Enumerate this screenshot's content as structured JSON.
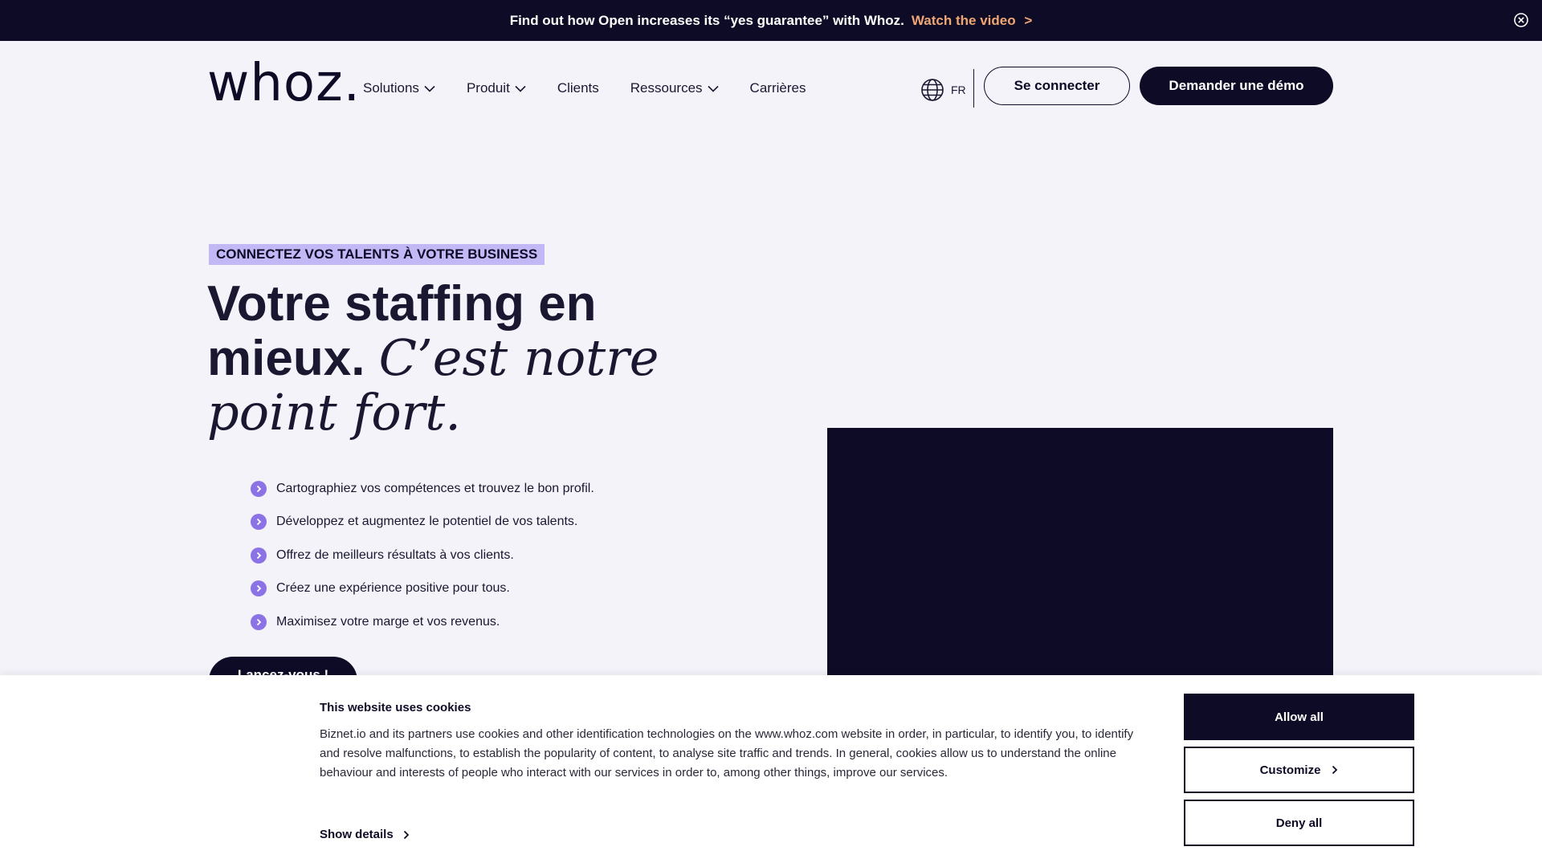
{
  "announcement": {
    "text": "Find out how Open increases its “yes guarantee” with Whoz.",
    "link_label": "Watch the video",
    "link_arrow": ">"
  },
  "header": {
    "logo": "whoz.",
    "nav": [
      {
        "label": "Solutions",
        "dropdown": true
      },
      {
        "label": "Produit",
        "dropdown": true
      },
      {
        "label": "Clients",
        "dropdown": false
      },
      {
        "label": "Ressources",
        "dropdown": true
      },
      {
        "label": "Carrières",
        "dropdown": false
      }
    ],
    "language": "FR",
    "login_label": "Se connecter",
    "demo_label": "Demander une démo"
  },
  "hero": {
    "eyebrow": "CONNECTEZ VOS TALENTS À VOTRE BUSINESS",
    "headline_plain_1": "Votre staffing en",
    "headline_plain_2": "mieux.",
    "headline_serif_1": "C’est notre",
    "headline_serif_2": "point fort.",
    "bullets": [
      "Cartographiez vos compétences et trouvez le bon profil.",
      "Développez et augmentez le potentiel de vos talents.",
      "Offrez de meilleurs résultats à vos clients.",
      "Créez une expérience positive pour tous.",
      "Maximisez votre marge et vos revenus."
    ],
    "cta_label": "Lancez-vous !"
  },
  "cookie": {
    "title": "This website uses cookies",
    "text": "Biznet.io and its partners use cookies and other identification technologies on the www.whoz.com website in order, in particular, to identify you, to identify and resolve malfunctions, to establish the popularity of content, to analyse site traffic and trends. In general, cookies allow us to understand the online behaviour and interests of people who interact with our services in order to, among other things, improve our services.",
    "show_details": "Show details",
    "allow_all": "Allow all",
    "customize": "Customize",
    "deny_all": "Deny all"
  },
  "colors": {
    "dark_navy": "#0d0b26",
    "accent_purple": "#8b73e6",
    "eyebrow_bg": "#c1b8f5",
    "link_orange": "#f0a674",
    "page_bg": "#f4f3fa"
  }
}
